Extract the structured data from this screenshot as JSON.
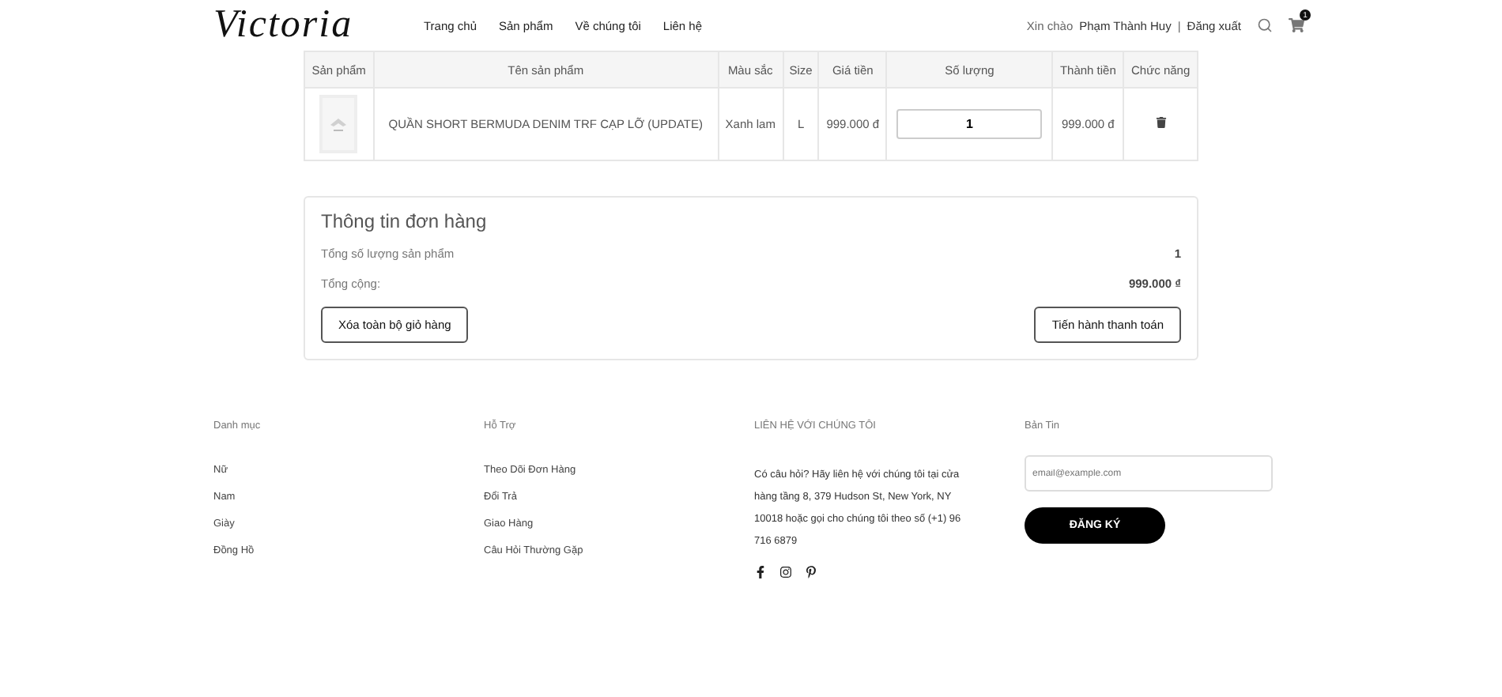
{
  "header": {
    "logo": "Victoria",
    "nav": [
      {
        "label": "Trang chủ"
      },
      {
        "label": "Sản phẩm"
      },
      {
        "label": "Về chúng tôi"
      },
      {
        "label": "Liên hệ"
      }
    ],
    "greeting": "Xin chào",
    "user": "Phạm Thành Huy",
    "separator": "|",
    "logout": "Đăng xuất",
    "cart_count": "1"
  },
  "cart_table": {
    "columns": [
      "Sản phẩm",
      "Tên sản phẩm",
      "Màu sắc",
      "Size",
      "Giá tiền",
      "Số lượng",
      "Thành tiền",
      "Chức năng"
    ],
    "rows": [
      {
        "name": "QUẦN SHORT BERMUDA DENIM TRF CẠP LỠ (UPDATE)",
        "variant": "Xanh lam",
        "size": "L",
        "price": "999.000 đ",
        "quantity": "1",
        "total": "999.000 đ"
      }
    ]
  },
  "order_summary": {
    "title": "Thông tin đơn hàng",
    "lines": [
      {
        "label": "Tổng số lượng sản phẩm",
        "value": "1"
      },
      {
        "label": "Tổng cộng:",
        "value": "999.000 ₫"
      }
    ],
    "clear_button": "Xóa toàn bộ giỏ hàng",
    "checkout_button": "Tiến hành thanh toán"
  },
  "footer": {
    "columns": [
      {
        "title": "Danh mục",
        "links": [
          "Nữ",
          "Nam",
          "Giày",
          "Đồng Hồ"
        ]
      },
      {
        "title": "Hỗ Trợ",
        "links": [
          "Theo Dõi Đơn Hàng",
          "Đổi Trả",
          "Giao Hàng",
          "Câu Hỏi Thường Gặp"
        ]
      }
    ],
    "contact": {
      "title": "LIÊN HỆ VỚI CHÚNG TÔI",
      "text": "Có câu hỏi? Hãy liên hệ với chúng tôi tại cửa hàng tầng 8, 379 Hudson St, New York, NY 10018 hoặc gọi cho chúng tôi theo số (+1) 96 716 6879",
      "socials": [
        {
          "kind": "facebook"
        },
        {
          "kind": "instagram"
        },
        {
          "kind": "pinterest"
        }
      ]
    },
    "newsletter": {
      "title": "Bản Tin",
      "placeholder": "email@example.com",
      "button": "ĐĂNG KÝ"
    }
  }
}
